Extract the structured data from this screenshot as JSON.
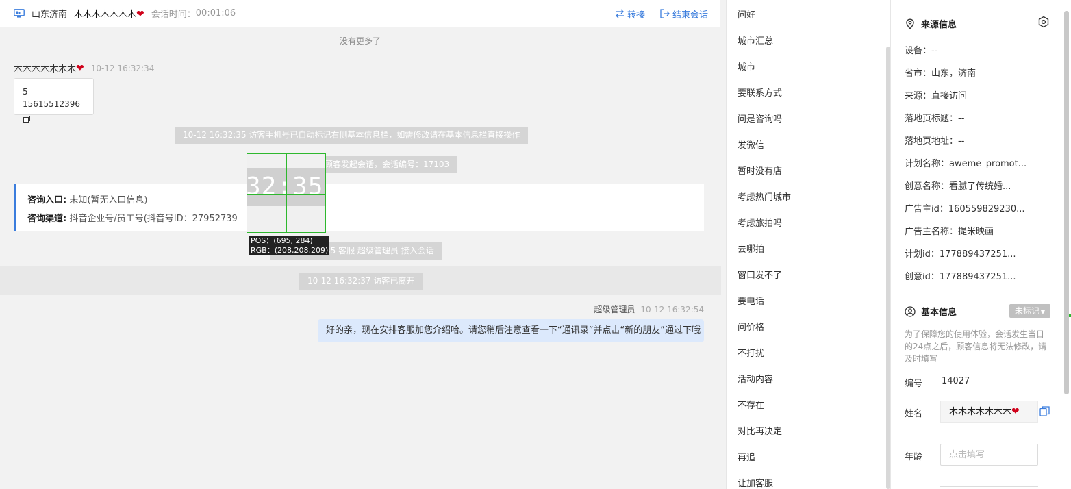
{
  "header": {
    "region": "山东济南",
    "visitor_name": "木木木木木木木",
    "session_time_label": "会话时间：",
    "session_time": "00:01:06",
    "transfer_label": "转接",
    "end_label": "结束会话"
  },
  "chat": {
    "no_more": "没有更多了",
    "visitor_msg": {
      "name": "木木木木木木木",
      "time": "10-12 16:32:34",
      "line1": "5",
      "line2": "15615512396"
    },
    "system_1": "10-12 16:32:35 访客手机号已自动标记右侧基本信息栏，如需修改请在基本信息栏直接操作",
    "system_2": "顾客发起会话，会话编号：17103",
    "info_card": {
      "entry_label": "咨询入口:",
      "entry_value": "未知(暂无入口信息)",
      "channel_label": "咨询渠道:",
      "channel_value": "抖音企业号/员工号(抖音号ID：27952739"
    },
    "system_3": "35 客服 超级管理员 接入会话",
    "system_4": "10-12 16:32:37 访客已离开",
    "agent_msg": {
      "name": "超级管理员",
      "time": "10-12 16:32:54",
      "text": "好的亲，现在安排客服加您介绍哈。请您稍后注意查看一下“通讯录”并点击“新的朋友”通过下哦"
    },
    "magnifier": {
      "zoom_text": "32:35 讠",
      "pos": "POS：(695, 284)",
      "rgb": "RGB：(208,208,209)"
    }
  },
  "quick_replies": [
    "问好",
    "城市汇总",
    "城市",
    "要联系方式",
    "问是咨询吗",
    "发微信",
    "暂时没有店",
    "考虑热门城市",
    "考虑旅拍吗",
    "去哪拍",
    "窗口发不了",
    "要电话",
    "问价格",
    "不打扰",
    "活动内容",
    "不存在",
    "对比再决定",
    "再追",
    "让加客服"
  ],
  "source": {
    "title": "来源信息",
    "rows": [
      "设备：--",
      "省市：山东，济南",
      "来源：直接访问",
      "落地页标题：--",
      "落地页地址：--",
      "计划名称：aweme_promot...",
      "创意名称：看腻了传统婚...",
      "广告主id：160559829230...",
      "广告主名称：提米映画",
      "计划id：177889437251...",
      "创意id：177889437251..."
    ]
  },
  "basic": {
    "title": "基本信息",
    "tag_label": "未标记",
    "note": "为了保障您的使用体验，会话发生当日的24点之后，顾客信息将无法修改，请及时填写",
    "id_label": "编号",
    "id_value": "14027",
    "name_label": "姓名",
    "name_value": "木木木木木木木",
    "age_label": "年龄",
    "age_placeholder": "点击填写"
  },
  "colors": {
    "accent": "#3b7ddd",
    "system_bg": "#d5d5d5",
    "agent_bubble": "#dce9fc",
    "heart": "#d0021b",
    "crosshair": "#2eb82e"
  }
}
